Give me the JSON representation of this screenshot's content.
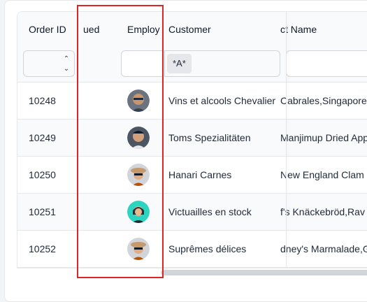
{
  "columns": {
    "order_id": "Order ID",
    "discontinued": "ued",
    "employee": "Employ",
    "customer": "Customer",
    "product_name": "ct Name"
  },
  "filters": {
    "customer_value": "*A*"
  },
  "icons": {
    "stepper_up": "chevron-up-icon",
    "stepper_down": "chevron-down-icon"
  },
  "rows": [
    {
      "order_id": "10248",
      "customer": "Vins et alcools Chevalier",
      "products": " Cabrales,Singapore",
      "avatar": "man-glasses"
    },
    {
      "order_id": "10249",
      "customer": "Toms Spezialitäten",
      "products": "Manjimup Dried App",
      "avatar": "man-smiling"
    },
    {
      "order_id": "10250",
      "customer": "Hanari Carnes",
      "products": " New England Clam",
      "avatar": "woman-hat"
    },
    {
      "order_id": "10251",
      "customer": "Victuailles en stock",
      "products": "f's Knäckebröd,Rav",
      "avatar": "woman-teal"
    },
    {
      "order_id": "10252",
      "customer": "Suprêmes délices",
      "products": "dney's Marmalade,G",
      "avatar": "woman-hat"
    }
  ],
  "colors": {
    "highlight": "#dc2626"
  }
}
